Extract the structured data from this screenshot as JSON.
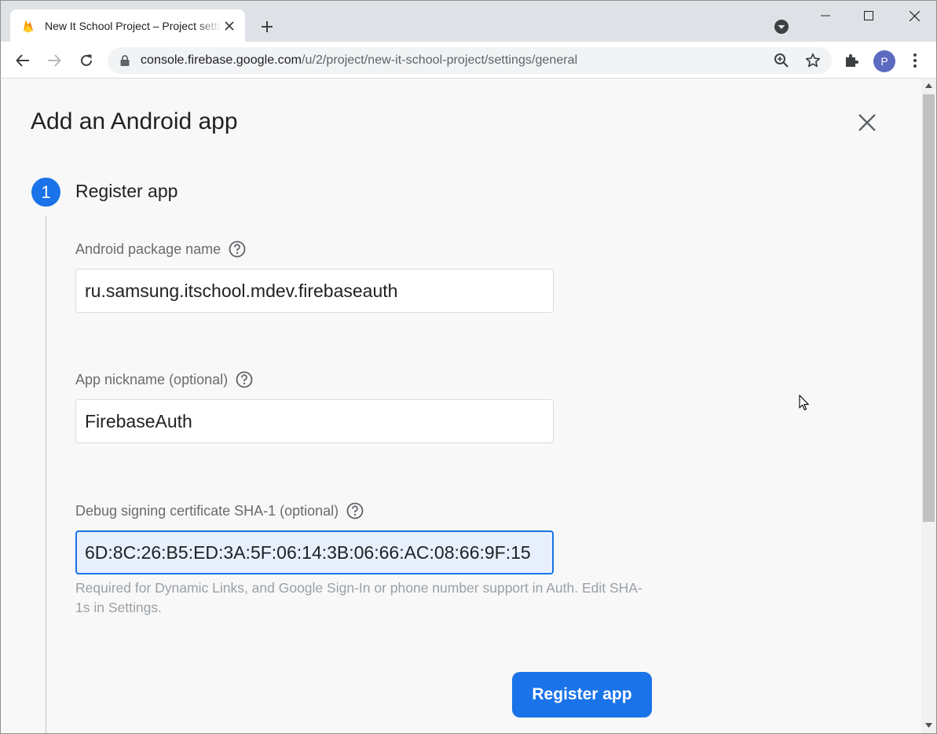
{
  "browser": {
    "tab": {
      "title": "New It School Project – Project settings",
      "favicon": "firebase-flame-icon"
    },
    "new_tab_icon": "plus-icon",
    "url_host": "console.firebase.google.com",
    "url_path": "/u/2/project/new-it-school-project/settings/general",
    "profile_initial": "P"
  },
  "dialog": {
    "title": "Add an Android app",
    "step": {
      "number": "1",
      "title": "Register app"
    },
    "fields": {
      "package": {
        "label": "Android package name",
        "value": "ru.samsung.itschool.mdev.firebaseauth"
      },
      "nickname": {
        "label": "App nickname (optional)",
        "value": "FirebaseAuth"
      },
      "sha1": {
        "label": "Debug signing certificate SHA-1 (optional)",
        "value": "6D:8C:26:B5:ED:3A:5F:06:14:3B:06:66:AC:08:66:9F:15"
      }
    },
    "hint": "Required for Dynamic Links, and Google Sign-In or phone number support in Auth. Edit SHA-1s in Settings.",
    "register_button": "Register app"
  },
  "colors": {
    "accent": "#1a73e8",
    "page_bg": "#f8f8f8",
    "chrome_bg": "#dee1e6"
  }
}
